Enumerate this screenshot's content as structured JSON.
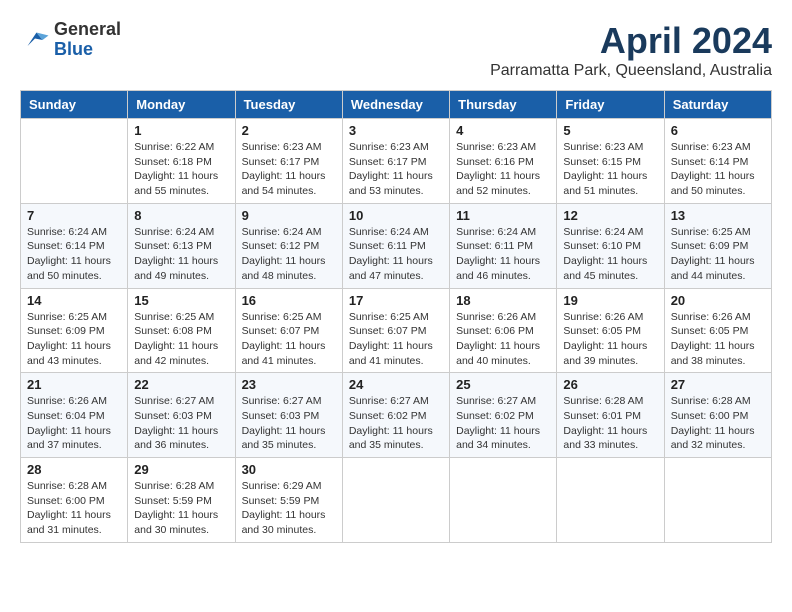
{
  "logo": {
    "general": "General",
    "blue": "Blue"
  },
  "title": "April 2024",
  "subtitle": "Parramatta Park, Queensland, Australia",
  "headers": [
    "Sunday",
    "Monday",
    "Tuesday",
    "Wednesday",
    "Thursday",
    "Friday",
    "Saturday"
  ],
  "weeks": [
    [
      {
        "day": "",
        "info": ""
      },
      {
        "day": "1",
        "info": "Sunrise: 6:22 AM\nSunset: 6:18 PM\nDaylight: 11 hours\nand 55 minutes."
      },
      {
        "day": "2",
        "info": "Sunrise: 6:23 AM\nSunset: 6:17 PM\nDaylight: 11 hours\nand 54 minutes."
      },
      {
        "day": "3",
        "info": "Sunrise: 6:23 AM\nSunset: 6:17 PM\nDaylight: 11 hours\nand 53 minutes."
      },
      {
        "day": "4",
        "info": "Sunrise: 6:23 AM\nSunset: 6:16 PM\nDaylight: 11 hours\nand 52 minutes."
      },
      {
        "day": "5",
        "info": "Sunrise: 6:23 AM\nSunset: 6:15 PM\nDaylight: 11 hours\nand 51 minutes."
      },
      {
        "day": "6",
        "info": "Sunrise: 6:23 AM\nSunset: 6:14 PM\nDaylight: 11 hours\nand 50 minutes."
      }
    ],
    [
      {
        "day": "7",
        "info": "Sunrise: 6:24 AM\nSunset: 6:14 PM\nDaylight: 11 hours\nand 50 minutes."
      },
      {
        "day": "8",
        "info": "Sunrise: 6:24 AM\nSunset: 6:13 PM\nDaylight: 11 hours\nand 49 minutes."
      },
      {
        "day": "9",
        "info": "Sunrise: 6:24 AM\nSunset: 6:12 PM\nDaylight: 11 hours\nand 48 minutes."
      },
      {
        "day": "10",
        "info": "Sunrise: 6:24 AM\nSunset: 6:11 PM\nDaylight: 11 hours\nand 47 minutes."
      },
      {
        "day": "11",
        "info": "Sunrise: 6:24 AM\nSunset: 6:11 PM\nDaylight: 11 hours\nand 46 minutes."
      },
      {
        "day": "12",
        "info": "Sunrise: 6:24 AM\nSunset: 6:10 PM\nDaylight: 11 hours\nand 45 minutes."
      },
      {
        "day": "13",
        "info": "Sunrise: 6:25 AM\nSunset: 6:09 PM\nDaylight: 11 hours\nand 44 minutes."
      }
    ],
    [
      {
        "day": "14",
        "info": "Sunrise: 6:25 AM\nSunset: 6:09 PM\nDaylight: 11 hours\nand 43 minutes."
      },
      {
        "day": "15",
        "info": "Sunrise: 6:25 AM\nSunset: 6:08 PM\nDaylight: 11 hours\nand 42 minutes."
      },
      {
        "day": "16",
        "info": "Sunrise: 6:25 AM\nSunset: 6:07 PM\nDaylight: 11 hours\nand 41 minutes."
      },
      {
        "day": "17",
        "info": "Sunrise: 6:25 AM\nSunset: 6:07 PM\nDaylight: 11 hours\nand 41 minutes."
      },
      {
        "day": "18",
        "info": "Sunrise: 6:26 AM\nSunset: 6:06 PM\nDaylight: 11 hours\nand 40 minutes."
      },
      {
        "day": "19",
        "info": "Sunrise: 6:26 AM\nSunset: 6:05 PM\nDaylight: 11 hours\nand 39 minutes."
      },
      {
        "day": "20",
        "info": "Sunrise: 6:26 AM\nSunset: 6:05 PM\nDaylight: 11 hours\nand 38 minutes."
      }
    ],
    [
      {
        "day": "21",
        "info": "Sunrise: 6:26 AM\nSunset: 6:04 PM\nDaylight: 11 hours\nand 37 minutes."
      },
      {
        "day": "22",
        "info": "Sunrise: 6:27 AM\nSunset: 6:03 PM\nDaylight: 11 hours\nand 36 minutes."
      },
      {
        "day": "23",
        "info": "Sunrise: 6:27 AM\nSunset: 6:03 PM\nDaylight: 11 hours\nand 35 minutes."
      },
      {
        "day": "24",
        "info": "Sunrise: 6:27 AM\nSunset: 6:02 PM\nDaylight: 11 hours\nand 35 minutes."
      },
      {
        "day": "25",
        "info": "Sunrise: 6:27 AM\nSunset: 6:02 PM\nDaylight: 11 hours\nand 34 minutes."
      },
      {
        "day": "26",
        "info": "Sunrise: 6:28 AM\nSunset: 6:01 PM\nDaylight: 11 hours\nand 33 minutes."
      },
      {
        "day": "27",
        "info": "Sunrise: 6:28 AM\nSunset: 6:00 PM\nDaylight: 11 hours\nand 32 minutes."
      }
    ],
    [
      {
        "day": "28",
        "info": "Sunrise: 6:28 AM\nSunset: 6:00 PM\nDaylight: 11 hours\nand 31 minutes."
      },
      {
        "day": "29",
        "info": "Sunrise: 6:28 AM\nSunset: 5:59 PM\nDaylight: 11 hours\nand 30 minutes."
      },
      {
        "day": "30",
        "info": "Sunrise: 6:29 AM\nSunset: 5:59 PM\nDaylight: 11 hours\nand 30 minutes."
      },
      {
        "day": "",
        "info": ""
      },
      {
        "day": "",
        "info": ""
      },
      {
        "day": "",
        "info": ""
      },
      {
        "day": "",
        "info": ""
      }
    ]
  ]
}
